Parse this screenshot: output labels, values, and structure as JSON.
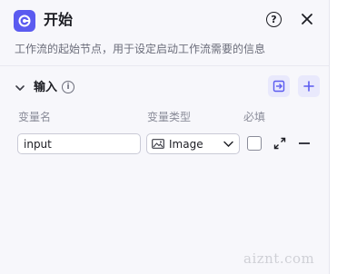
{
  "header": {
    "title": "开始",
    "description": "工作流的起始节点，用于设定启动工作流需要的信息",
    "help_glyph": "?",
    "icons": {
      "start": "start-node-icon",
      "help": "help-circle-icon",
      "close": "close-icon"
    }
  },
  "section": {
    "label": "输入",
    "info_glyph": "i",
    "icons": {
      "collapse": "chevron-down-icon",
      "info": "info-icon",
      "import": "import-icon",
      "add": "plus-icon"
    }
  },
  "columns": {
    "name": "变量名",
    "type": "变量类型",
    "required": "必填"
  },
  "variables": [
    {
      "name": "input",
      "type": "Image",
      "required": false,
      "icons": {
        "type": "image-icon",
        "expand": "expand-icon",
        "remove": "minus-icon"
      }
    }
  ],
  "watermark": "aiznt.com",
  "colors": {
    "accent": "#5b5bf0",
    "accent_soft": "#e9e9fc",
    "panel_bg": "#f7f7fb",
    "text": "#1c1d23",
    "muted": "#8a8c99"
  }
}
